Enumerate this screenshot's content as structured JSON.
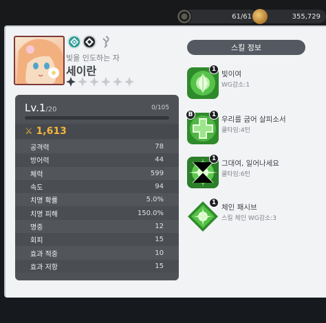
{
  "topbar": {
    "stamina": "61/61",
    "gold": "355,729"
  },
  "hero": {
    "title": "빛을 인도하는 자",
    "name": "세이란",
    "stars_filled": 1,
    "stars_total": 6
  },
  "stats": {
    "level": "Lv.1",
    "level_max": "/20",
    "exp": "0/105",
    "exp_progress": 0,
    "combat_power": "1,613",
    "rows": [
      {
        "label": "공격력",
        "value": "78"
      },
      {
        "label": "방어력",
        "value": "44"
      },
      {
        "label": "체력",
        "value": "599"
      },
      {
        "label": "속도",
        "value": "94"
      },
      {
        "label": "치명 확률",
        "value": "5.0%"
      },
      {
        "label": "치명 피해",
        "value": "150.0%"
      },
      {
        "label": "명중",
        "value": "12"
      },
      {
        "label": "회피",
        "value": "15"
      },
      {
        "label": "효과 적중",
        "value": "10"
      },
      {
        "label": "효과 저항",
        "value": "15"
      }
    ]
  },
  "skills": {
    "header": "스킬 정보",
    "items": [
      {
        "level": "1",
        "name": "빛이여",
        "desc": "WG감소:1",
        "badge": ""
      },
      {
        "level": "1",
        "name": "우리를 굽어 살피소서",
        "desc": "쿨타임:4턴",
        "badge": "B"
      },
      {
        "level": "1",
        "name": "그대여, 일어나세요",
        "desc": "쿨타임:6턴",
        "badge": ""
      },
      {
        "level": "1",
        "name": "체인 패시브",
        "desc": "스킬 체인 WG감소:3",
        "badge": ""
      }
    ]
  },
  "colors": {
    "accent_gold": "#f3b63c",
    "skill_green": "#3fa63a",
    "panel_bg": "#f2f3f5",
    "stat_bg": "#4e5257"
  }
}
